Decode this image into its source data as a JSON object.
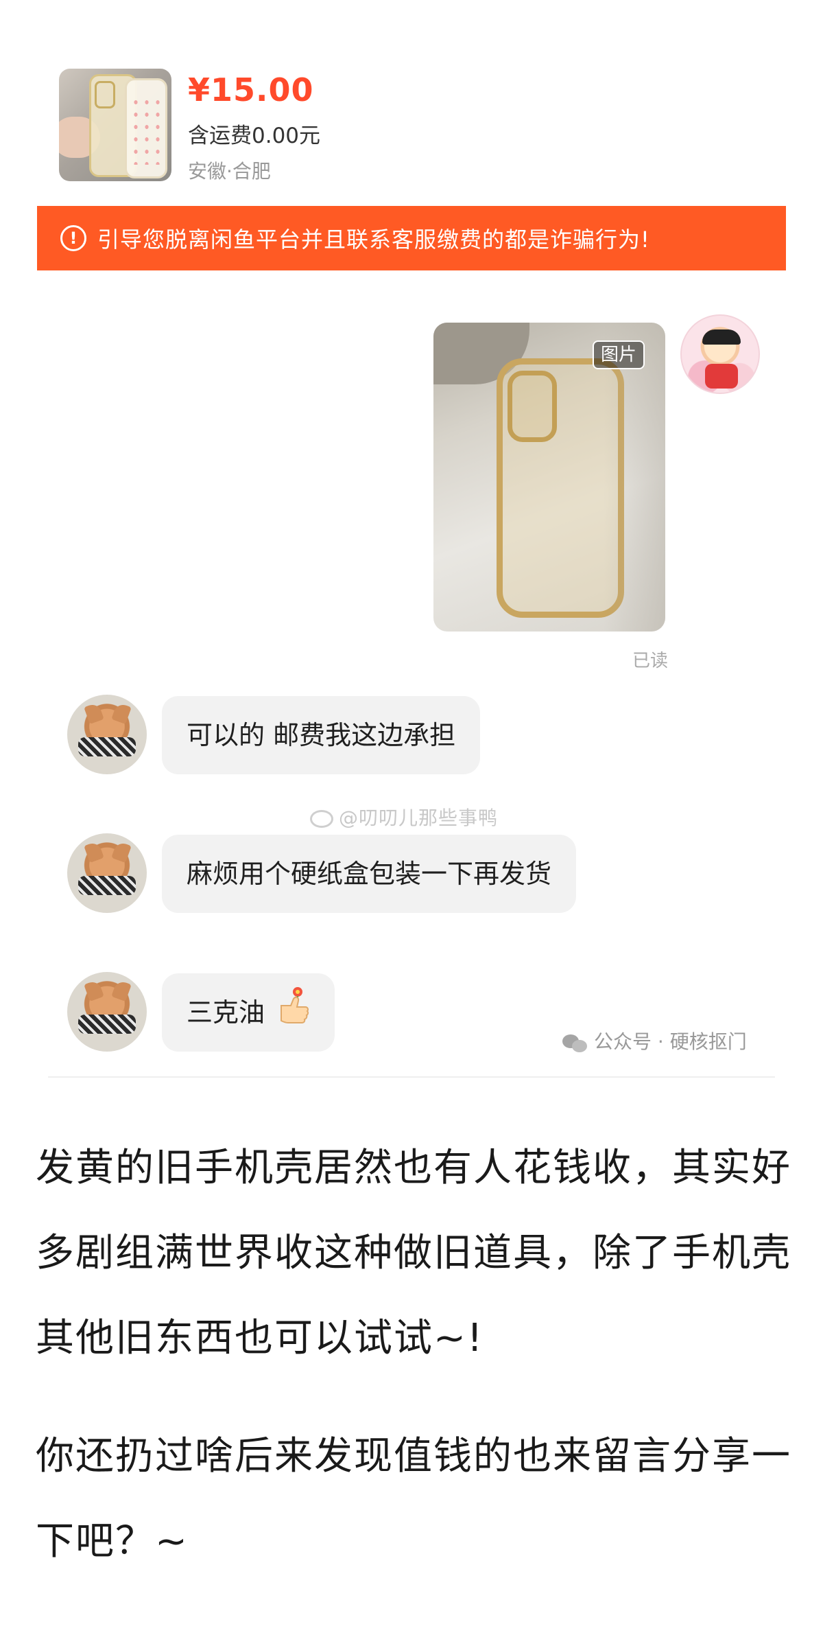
{
  "product": {
    "price": "¥15.00",
    "shipping": "含运费0.00元",
    "location": "安徽·合肥"
  },
  "warning": {
    "icon": "exclamation-circle-icon",
    "text": "引导您脱离闲鱼平台并且联系客服缴费的都是诈骗行为!"
  },
  "chat": {
    "sent_image": {
      "tag": "图片",
      "status": "已读"
    },
    "messages": [
      {
        "text": "可以的 邮费我这边承担"
      },
      {
        "text": "麻烦用个硬纸盒包装一下再发货"
      },
      {
        "text": "三克油"
      }
    ]
  },
  "watermarks": {
    "weibo": "@叨叨儿那些事鸭",
    "wechat": "公众号 · 硬核抠门"
  },
  "article": {
    "paragraph1": "发黄的旧手机壳居然也有人花钱收，其实好多剧组满世界收这种做旧道具，除了手机壳其他旧东西也可以试试~!",
    "paragraph2": "你还扔过啥后来发现值钱的也来留言分享一下吧？~"
  },
  "colors": {
    "price": "#ff4a2b",
    "warning_bg": "#ff5a24",
    "bubble_bg": "#f2f2f2"
  }
}
